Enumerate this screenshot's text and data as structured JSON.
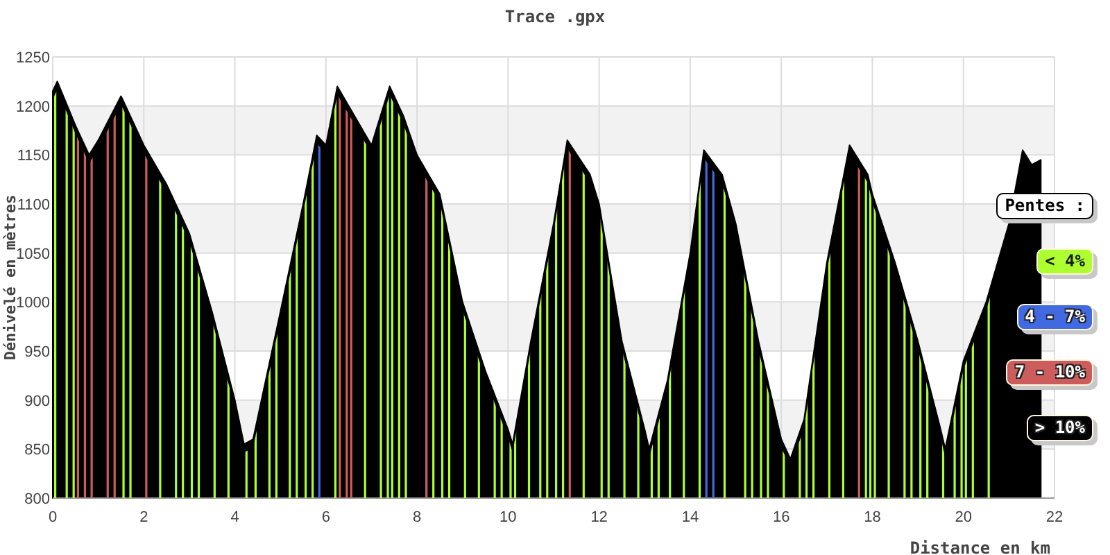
{
  "chart": {
    "chart_data": {
      "type": "area",
      "title": "Trace .gpx",
      "xlabel": "Distance en km",
      "ylabel": "Dénivelé en mètres",
      "x": [
        0,
        0.1,
        0.5,
        0.8,
        1,
        1.5,
        2,
        2.5,
        3,
        3.5,
        4,
        4.2,
        4.4,
        5,
        5.5,
        5.8,
        6,
        6.25,
        6.5,
        7,
        7.4,
        7.7,
        8,
        8.5,
        9,
        9.5,
        10,
        10.1,
        10.5,
        11,
        11.3,
        11.8,
        12,
        12.5,
        13,
        13.1,
        13.5,
        14,
        14.3,
        14.7,
        15,
        15.5,
        16,
        16.2,
        16.5,
        17,
        17.5,
        17.9,
        18,
        18.5,
        19,
        19.5,
        19.6,
        20,
        20.5,
        21,
        21.3,
        21.5,
        21.7
      ],
      "grid": true,
      "series": [
        {
          "color": "#000000",
          "values": [
            1215,
            1225,
            1180,
            1150,
            1165,
            1210,
            1160,
            1120,
            1070,
            990,
            900,
            855,
            860,
            990,
            1100,
            1170,
            1160,
            1220,
            1200,
            1160,
            1220,
            1190,
            1150,
            1110,
            1000,
            930,
            870,
            855,
            960,
            1080,
            1165,
            1130,
            1100,
            960,
            870,
            850,
            920,
            1050,
            1155,
            1130,
            1080,
            960,
            860,
            840,
            880,
            1040,
            1160,
            1130,
            1110,
            1040,
            960,
            870,
            850,
            940,
            1000,
            1080,
            1155,
            1140,
            1145
          ]
        }
      ],
      "xlim": [
        0,
        22
      ],
      "ylim": [
        800,
        1250
      ],
      "xticks": [
        0,
        2,
        4,
        6,
        8,
        10,
        12,
        14,
        16,
        18,
        20,
        22
      ],
      "yticks": [
        800,
        850,
        900,
        950,
        1000,
        1050,
        1100,
        1150,
        1200,
        1250
      ]
    }
  },
  "legend": {
    "title": "Pentes :",
    "items": [
      {
        "label": "< 4%",
        "color": "#adff2f"
      },
      {
        "label": "4 - 7%",
        "color": "#4169e1"
      },
      {
        "label": "7 - 10%",
        "color": "#cd5c5c"
      },
      {
        "label": "> 10%",
        "color": "#000000"
      }
    ]
  }
}
